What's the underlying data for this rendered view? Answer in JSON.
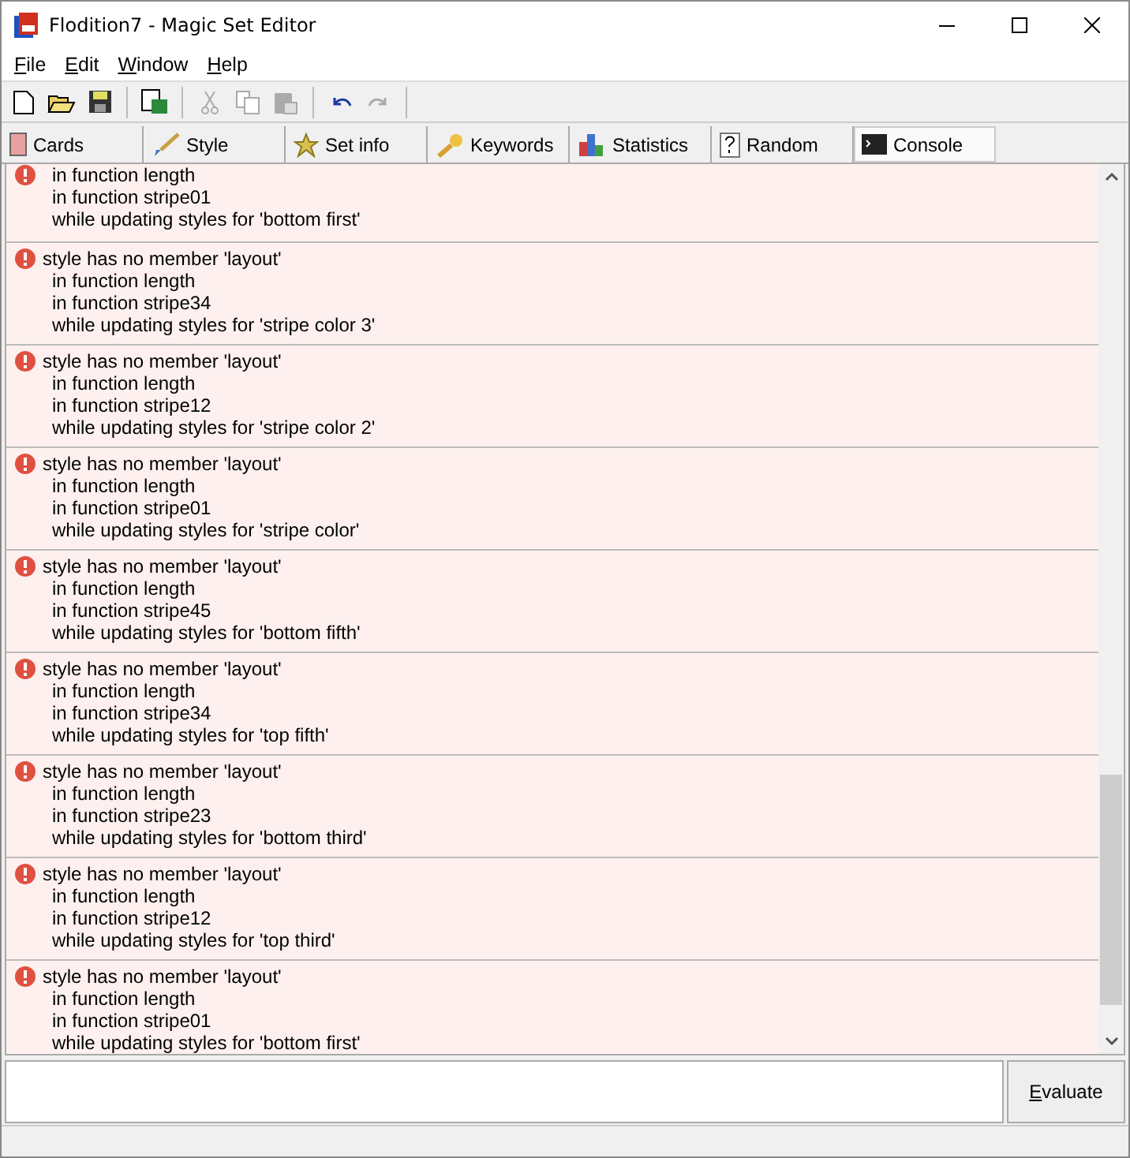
{
  "window": {
    "title": "Flodition7 - Magic Set Editor"
  },
  "menu": [
    "File",
    "Edit",
    "Window",
    "Help"
  ],
  "toolbar": [
    {
      "kind": "new",
      "disabled": false
    },
    {
      "kind": "open",
      "disabled": false
    },
    {
      "kind": "save",
      "disabled": false
    },
    {
      "kind": "sep"
    },
    {
      "kind": "export",
      "disabled": false
    },
    {
      "kind": "sep"
    },
    {
      "kind": "cut",
      "disabled": true
    },
    {
      "kind": "copy",
      "disabled": true
    },
    {
      "kind": "paste",
      "disabled": true
    },
    {
      "kind": "sep"
    },
    {
      "kind": "undo",
      "disabled": false
    },
    {
      "kind": "redo",
      "disabled": true
    },
    {
      "kind": "sep"
    }
  ],
  "tabs": [
    {
      "label": "Cards",
      "kind": "cards",
      "selected": false
    },
    {
      "label": "Style",
      "kind": "style",
      "selected": false
    },
    {
      "label": "Set info",
      "kind": "setinfo",
      "selected": false
    },
    {
      "label": "Keywords",
      "kind": "keywords",
      "selected": false
    },
    {
      "label": "Statistics",
      "kind": "statistics",
      "selected": false
    },
    {
      "label": "Random",
      "kind": "random",
      "selected": false
    },
    {
      "label": "Console",
      "kind": "console",
      "selected": true
    }
  ],
  "console": {
    "messages": [
      {
        "kind": "error",
        "trace": [
          "in function length",
          "in function stripe01",
          "while updating styles for 'bottom first'"
        ]
      },
      {
        "kind": "error",
        "message": "style has no member 'layout'",
        "trace": [
          "in function length",
          "in function stripe34",
          "while updating styles for 'stripe color 3'"
        ]
      },
      {
        "kind": "error",
        "message": "style has no member 'layout'",
        "trace": [
          "in function length",
          "in function stripe12",
          "while updating styles for 'stripe color 2'"
        ]
      },
      {
        "kind": "error",
        "message": "style has no member 'layout'",
        "trace": [
          "in function length",
          "in function stripe01",
          "while updating styles for 'stripe color'"
        ]
      },
      {
        "kind": "error",
        "message": "style has no member 'layout'",
        "trace": [
          "in function length",
          "in function stripe45",
          "while updating styles for 'bottom fifth'"
        ]
      },
      {
        "kind": "error",
        "message": "style has no member 'layout'",
        "trace": [
          "in function length",
          "in function stripe34",
          "while updating styles for 'top fifth'"
        ]
      },
      {
        "kind": "error",
        "message": "style has no member 'layout'",
        "trace": [
          "in function length",
          "in function stripe23",
          "while updating styles for 'bottom third'"
        ]
      },
      {
        "kind": "error",
        "message": "style has no member 'layout'",
        "trace": [
          "in function length",
          "in function stripe12",
          "while updating styles for 'top third'"
        ]
      },
      {
        "kind": "error",
        "message": "style has no member 'layout'",
        "trace": [
          "in function length",
          "in function stripe01",
          "while updating styles for 'bottom first'"
        ]
      }
    ],
    "evaluate_button": "Evaluate"
  }
}
